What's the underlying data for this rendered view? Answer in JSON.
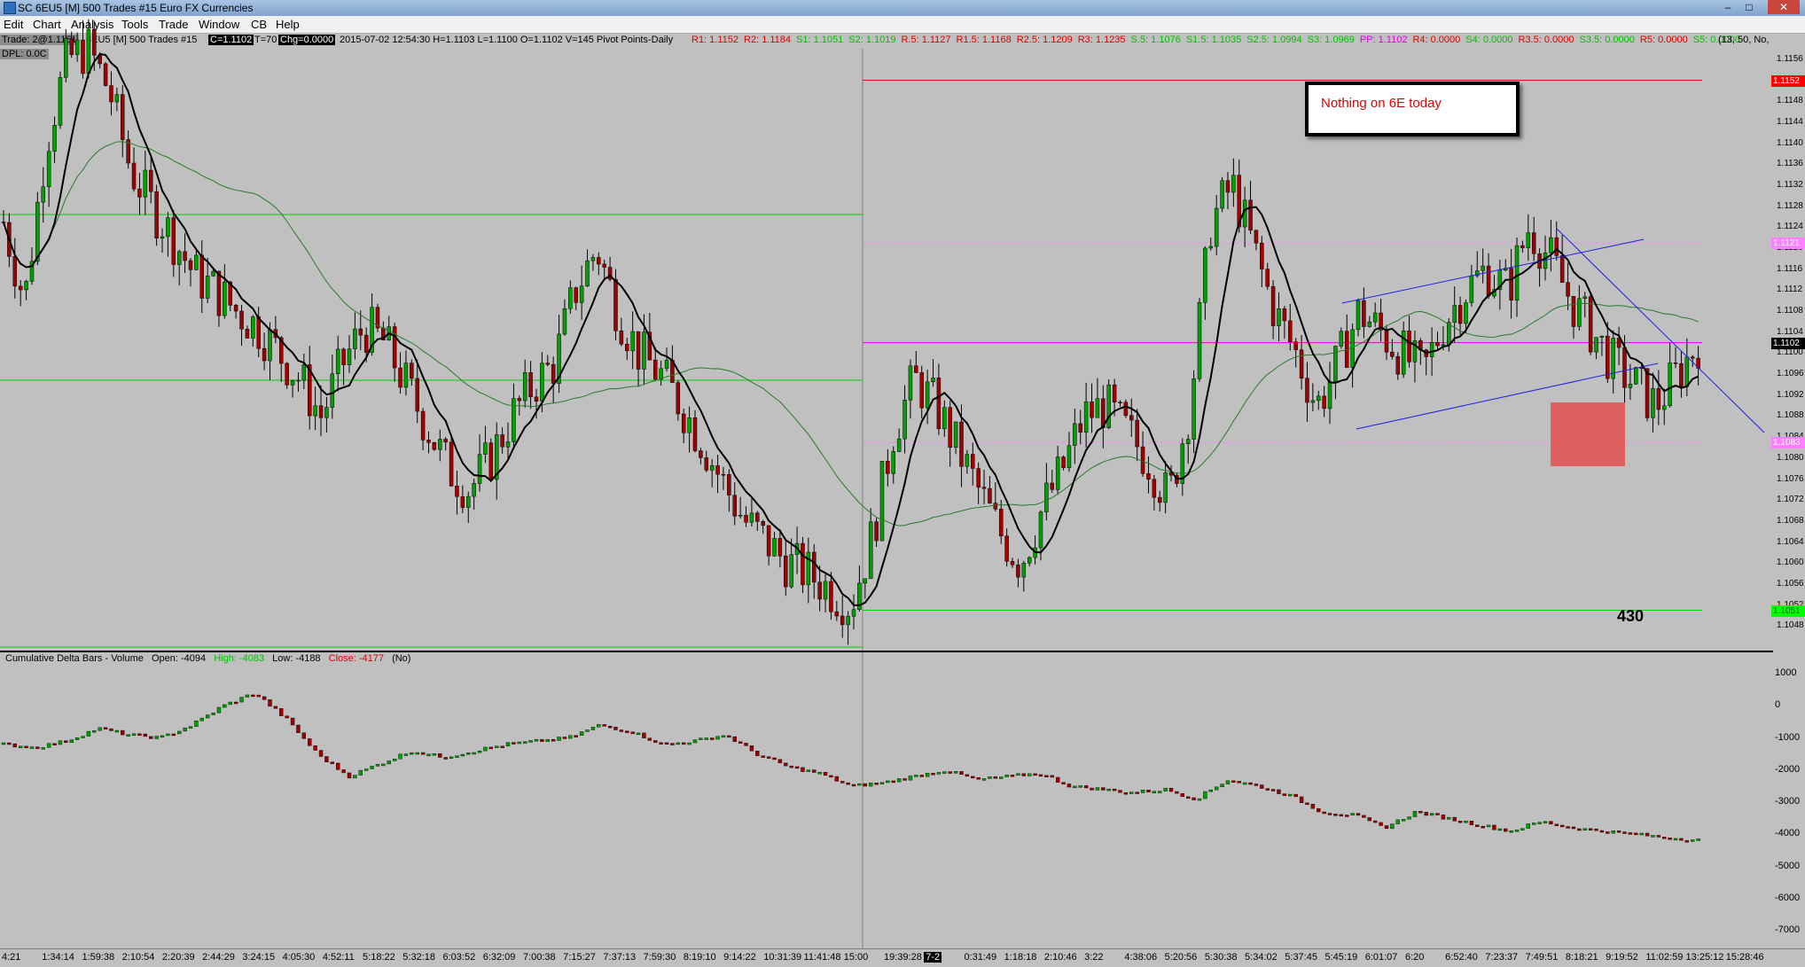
{
  "window": {
    "title": "SC 6EU5 [M]  500 Trades  #15  Euro FX Currencies",
    "buttons": [
      "–",
      "□",
      "✕"
    ]
  },
  "menu": [
    "Edit",
    "Chart",
    "Analysis",
    "Tools",
    "Trade",
    "Window",
    "CB",
    "Help"
  ],
  "info_bar": {
    "trade": "Trade: 2@1.1161",
    "symbol": "6EU5 [M]  500 Trades  #15",
    "close": "C=1.1102",
    "t": "T=70",
    "chg": "Chg=0.0000",
    "stats": "2015-07-02 12:54:30 H=1.1103 L=1.1100 O=1.1102 V=145 Pivot Points-Daily",
    "pivots": [
      {
        "text": "R1: 1.1152",
        "color": "#e00000"
      },
      {
        "text": "R2: 1.1184",
        "color": "#e00000"
      },
      {
        "text": "S1: 1.1051",
        "color": "#00c000"
      },
      {
        "text": "S2: 1.1019",
        "color": "#00c000"
      },
      {
        "text": "R.5: 1.1127",
        "color": "#e00000"
      },
      {
        "text": "R1.5: 1.1168",
        "color": "#e00000"
      },
      {
        "text": "R2.5: 1.1209",
        "color": "#e00000"
      },
      {
        "text": "R3: 1.1235",
        "color": "#e00000"
      },
      {
        "text": "S.5: 1.1076",
        "color": "#00c000"
      },
      {
        "text": "S1.5: 1.1035",
        "color": "#00c000"
      },
      {
        "text": "S2.5: 1.0994",
        "color": "#00c000"
      },
      {
        "text": "S3: 1.0969",
        "color": "#00c000"
      },
      {
        "text": "PP: 1.1102",
        "color": "#e000e0"
      },
      {
        "text": "R4: 0.0000",
        "color": "#e00000"
      },
      {
        "text": "S4: 0.0000",
        "color": "#00c000"
      },
      {
        "text": "R3.5: 0.0000",
        "color": "#e00000"
      },
      {
        "text": "S3.5: 0.0000",
        "color": "#00c000"
      },
      {
        "text": "R5: 0.0000",
        "color": "#e00000"
      },
      {
        "text": "S5: 0.0000",
        "color": "#00c000"
      }
    ],
    "params": "(13, 50, No,"
  },
  "dpl": "DPL: 0.0C",
  "price_axis": {
    "ticks": [
      "1.1156",
      "1.1152",
      "1.1148",
      "1.1144",
      "1.1140",
      "1.1136",
      "1.1132",
      "1.1128",
      "1.1124",
      "1.1120",
      "1.1116",
      "1.1112",
      "1.1108",
      "1.1104",
      "1.1100",
      "1.1096",
      "1.1092",
      "1.1088",
      "1.1084",
      "1.1080",
      "1.1076",
      "1.1072",
      "1.1068",
      "1.1064",
      "1.1060",
      "1.1056",
      "1.1052",
      "1.1048"
    ],
    "tags": [
      {
        "text": "1.1152",
        "bg": "#ff0000",
        "fg": "#ffffff",
        "price": 1.1152
      },
      {
        "text": "1.1121",
        "bg": "#ff80ff",
        "fg": "#ffffff",
        "price": 1.1121
      },
      {
        "text": "1.1102",
        "bg": "#000000",
        "fg": "#ffffff",
        "price": 1.1102
      },
      {
        "text": "1.1083",
        "bg": "#ff80ff",
        "fg": "#ffffff",
        "price": 1.1083
      },
      {
        "text": "1.1051",
        "bg": "#00ff00",
        "fg": "#006000",
        "price": 1.1051
      }
    ]
  },
  "note": "Nothing on 6E today",
  "level_label": "430",
  "indicator": {
    "name": "Cumulative Delta Bars - Volume",
    "open": "Open: -4094",
    "high": "High: -4083",
    "low": "Low: -4188",
    "close": "Close: -4177",
    "flag": "(No)",
    "colors": {
      "high": "#00c000",
      "close": "#e00000"
    }
  },
  "delta_axis": {
    "ticks": [
      "1000",
      "0",
      "-1000",
      "-2000",
      "-3000",
      "-4000",
      "-5000",
      "-6000",
      "-7000"
    ]
  },
  "time_axis": {
    "ticks": [
      "4:21",
      "1:34:14",
      "1:59:38",
      "2:10:54",
      "2:20:39",
      "2:44:29",
      "3:24:15",
      "4:05:30",
      "4:52:11",
      "5:18:22",
      "5:32:18",
      "6:03:52",
      "6:32:09",
      "7:00:38",
      "7:15:27",
      "7:37:13",
      "7:59:30",
      "8:19:10",
      "9:14:22",
      "10:31:39",
      "11:41:48",
      "15:00",
      "19:39:28",
      "7-2",
      "0:31:49",
      "1:18:18",
      "2:10:46",
      "3:22",
      "4:38:06",
      "5:20:56",
      "5:30:38",
      "5:34:02",
      "5:37:45",
      "5:45:19",
      "6:01:07",
      "6:20",
      "6:52:40",
      "7:23:37",
      "7:49:51",
      "8:18:21",
      "9:19:52",
      "11:02:59",
      "13:25:12",
      "15:28:46"
    ]
  },
  "chart_data": {
    "type": "candlestick",
    "symbol": "6EU5",
    "y_range": [
      1.1044,
      1.1158
    ],
    "pivot_levels": {
      "R1": 1.1152,
      "PP": 1.1102,
      "S1": 1.1051
    },
    "price_path": [
      1.1125,
      1.111,
      1.114,
      1.1156,
      1.1158,
      1.115,
      1.1135,
      1.1128,
      1.1122,
      1.1115,
      1.1112,
      1.1108,
      1.1105,
      1.11,
      1.1095,
      1.1088,
      1.1098,
      1.1105,
      1.1102,
      1.1094,
      1.1086,
      1.1078,
      1.1074,
      1.108,
      1.1088,
      1.1094,
      1.1098,
      1.1112,
      1.112,
      1.1108,
      1.11,
      1.1096,
      1.109,
      1.1083,
      1.1075,
      1.1068,
      1.1064,
      1.106,
      1.1058,
      1.1055,
      1.1052,
      1.1065,
      1.1085,
      1.1095,
      1.109,
      1.1082,
      1.1074,
      1.1066,
      1.106,
      1.107,
      1.1078,
      1.1088,
      1.109,
      1.1085,
      1.108,
      1.1072,
      1.109,
      1.1125,
      1.1132,
      1.112,
      1.1108,
      1.11,
      1.109,
      1.1098,
      1.1108,
      1.1104,
      1.11,
      1.1096,
      1.1106,
      1.1112,
      1.1116,
      1.1112,
      1.1124,
      1.1118,
      1.111,
      1.1104,
      1.1098,
      1.1094,
      1.109,
      1.1096,
      1.1102
    ],
    "delta_path": [
      -1200,
      -1300,
      -1100,
      -700,
      -900,
      -1000,
      -600,
      0,
      400,
      -400,
      -1500,
      -2200,
      -1800,
      -1400,
      -1600,
      -1400,
      -1200,
      -1100,
      -1000,
      -600,
      -800,
      -1200,
      -1100,
      -900,
      -1500,
      -1900,
      -2100,
      -2500,
      -2400,
      -2200,
      -2000,
      -2300,
      -2200,
      -2100,
      -2500,
      -2600,
      -2700,
      -2600,
      -2900,
      -2300,
      -2500,
      -2800,
      -3300,
      -3400,
      -3800,
      -3300,
      -3500,
      -3700,
      -3900,
      -3600,
      -3800,
      -3900,
      -4000,
      -4100,
      -4177
    ],
    "sessions": [
      {
        "label": "15:00"
      }
    ]
  }
}
